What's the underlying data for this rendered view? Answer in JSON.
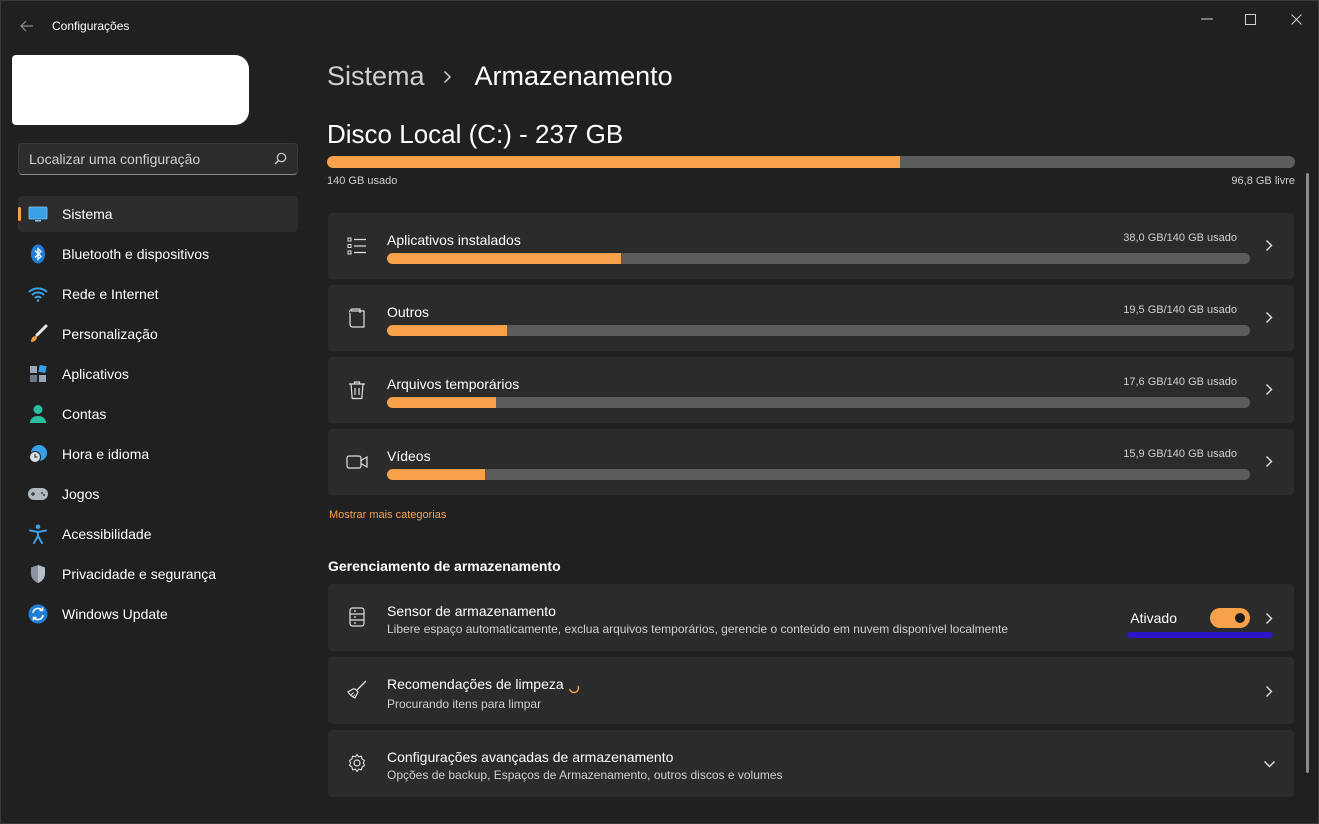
{
  "window": {
    "title": "Configurações",
    "controls": [
      "minimize-icon",
      "maximize-icon",
      "close-icon"
    ]
  },
  "sidebar": {
    "search": {
      "placeholder": "Localizar uma configuração",
      "value": ""
    },
    "items": [
      {
        "label": "Sistema",
        "icon": "monitor-icon",
        "active": true
      },
      {
        "label": "Bluetooth e dispositivos",
        "icon": "bluetooth-icon",
        "active": false
      },
      {
        "label": "Rede e Internet",
        "icon": "wifi-icon",
        "active": false
      },
      {
        "label": "Personalização",
        "icon": "brush-icon",
        "active": false
      },
      {
        "label": "Aplicativos",
        "icon": "apps-icon",
        "active": false
      },
      {
        "label": "Contas",
        "icon": "person-icon",
        "active": false
      },
      {
        "label": "Hora e idioma",
        "icon": "globe-clock-icon",
        "active": false
      },
      {
        "label": "Jogos",
        "icon": "gamepad-icon",
        "active": false
      },
      {
        "label": "Acessibilidade",
        "icon": "accessibility-icon",
        "active": false
      },
      {
        "label": "Privacidade e segurança",
        "icon": "shield-icon",
        "active": false
      },
      {
        "label": "Windows Update",
        "icon": "update-icon",
        "active": false
      }
    ]
  },
  "main": {
    "breadcrumb": {
      "parent": "Sistema",
      "current": "Armazenamento"
    },
    "disk": {
      "title": "Disco Local (C:) - 237 GB",
      "used_label": "140 GB usado",
      "free_label": "96,8 GB livre",
      "used_fraction": 0.592
    },
    "categories": [
      {
        "name": "Aplicativos instalados",
        "usage": "38,0 GB/140 GB usado",
        "fraction": 0.271,
        "icon": "list-icon"
      },
      {
        "name": "Outros",
        "usage": "19,5 GB/140 GB usado",
        "fraction": 0.139,
        "icon": "document-icon"
      },
      {
        "name": "Arquivos temporários",
        "usage": "17,6 GB/140 GB usado",
        "fraction": 0.126,
        "icon": "trash-icon"
      },
      {
        "name": "Vídeos",
        "usage": "15,9 GB/140 GB usado",
        "fraction": 0.114,
        "icon": "video-icon"
      }
    ],
    "more_categories": "Mostrar mais categorias",
    "management": {
      "title": "Gerenciamento de armazenamento",
      "sense": {
        "title": "Sensor de armazenamento",
        "desc": "Libere espaço automaticamente, exclua arquivos temporários, gerencie o conteúdo em nuvem disponível localmente",
        "toggle_label": "Ativado",
        "enabled": true
      },
      "cleanup": {
        "title": "Recomendações de limpeza",
        "desc": "Procurando itens para limpar"
      },
      "advanced": {
        "title": "Configurações avançadas de armazenamento",
        "desc": "Opções de backup, Espaços de Armazenamento, outros discos e volumes"
      }
    }
  },
  "colors": {
    "accent": "#f7a24b",
    "background": "#202020",
    "card": "#2b2b2b",
    "highlight_mark": "#2b15c4"
  }
}
